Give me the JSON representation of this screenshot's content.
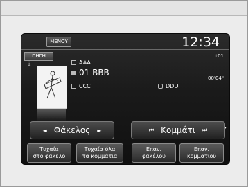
{
  "header": {
    "menu_label": "ΜΕΝΟΥ",
    "clock": "12:34"
  },
  "source": {
    "label": "ΠΗΓΗ"
  },
  "track_number": "01",
  "info": {
    "album": "AAA",
    "track": "01 BBB",
    "artist": "CCC",
    "folder": "DDD"
  },
  "elapsed": "00'04\"",
  "controls": {
    "folder_label": "Φάκελος",
    "track_label": "Κομμάτι"
  },
  "buttons": [
    {
      "line1": "Τυχαία",
      "line2": "στο φάκελο"
    },
    {
      "line1": "Τυχαία όλα",
      "line2": "τα κομμάτια"
    },
    {
      "line1": "Επαν.",
      "line2": "φακέλου"
    },
    {
      "line1": "Επαν.",
      "line2": "κομματιού"
    }
  ],
  "icons": {
    "usb": "usb-icon",
    "album": "album-icon",
    "track": "music-icon",
    "artist": "artist-icon",
    "folder": "folder-icon"
  }
}
